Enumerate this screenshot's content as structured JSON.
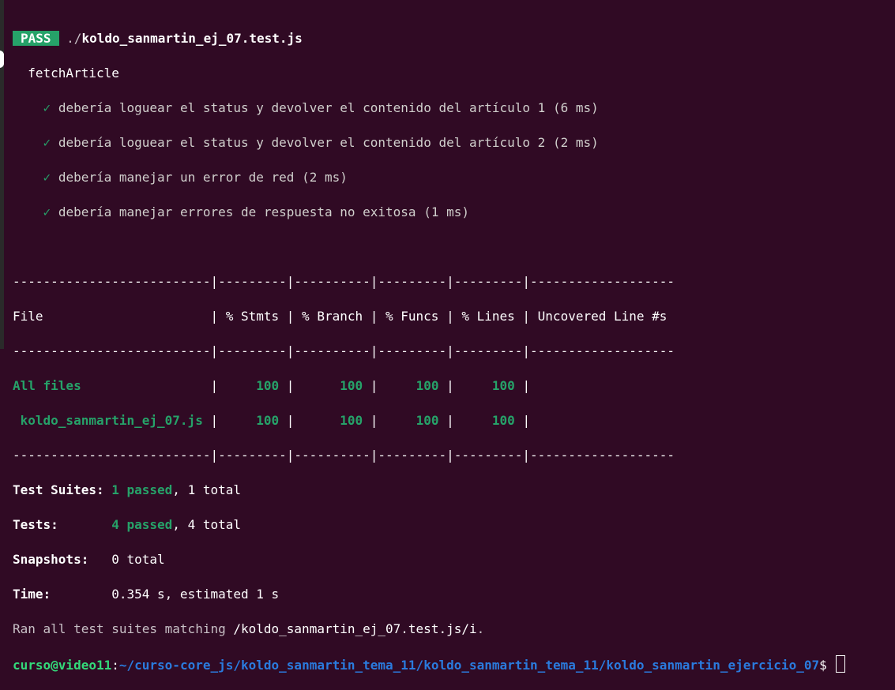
{
  "header": {
    "badge": "PASS",
    "path_prefix": "./",
    "file": "koldo_sanmartin_ej_07.test.js"
  },
  "suite": {
    "name": "fetchArticle",
    "check_glyph": "✓",
    "tests": [
      "debería loguear el status y devolver el contenido del artículo 1 (6 ms)",
      "debería loguear el status y devolver el contenido del artículo 2 (2 ms)",
      "debería manejar un error de red (2 ms)",
      "debería manejar errores de respuesta no exitosa (1 ms)"
    ]
  },
  "coverage": {
    "separator": "--------------------------|---------|----------|---------|---------|-------------------",
    "header_row": "File                      | % Stmts | % Branch | % Funcs | % Lines | Uncovered Line #s ",
    "rows": [
      {
        "file": "All files                 ",
        "stmts": "     100 ",
        "branch": "      100 ",
        "funcs": "     100 ",
        "lines": "     100 ",
        "uncovered": "                   "
      },
      {
        "file": " koldo_sanmartin_ej_07.js ",
        "stmts": "     100 ",
        "branch": "      100 ",
        "funcs": "     100 ",
        "lines": "     100 ",
        "uncovered": "                   "
      }
    ]
  },
  "summary": {
    "suites_label": "Test Suites:",
    "suites_passed": "1 passed",
    "suites_total": ", 1 total",
    "tests_label": "Tests:",
    "tests_passed": "4 passed",
    "tests_total": ", 4 total",
    "snapshots_label": "Snapshots:",
    "snapshots_value": "0 total",
    "time_label": "Time:",
    "time_value": "0.354 s, estimated 1 s",
    "ran_prefix": "Ran all test suites matching ",
    "ran_pattern": "/koldo_sanmartin_ej_07.test.js/i",
    "ran_suffix": "."
  },
  "prompt": {
    "user_host": "curso@video11",
    "colon": ":",
    "path": "~/curso-core_js/koldo_sanmartin_tema_11/koldo_sanmartin_tema_11/koldo_sanmartin_ejercicio_07",
    "symbol": "$ "
  }
}
